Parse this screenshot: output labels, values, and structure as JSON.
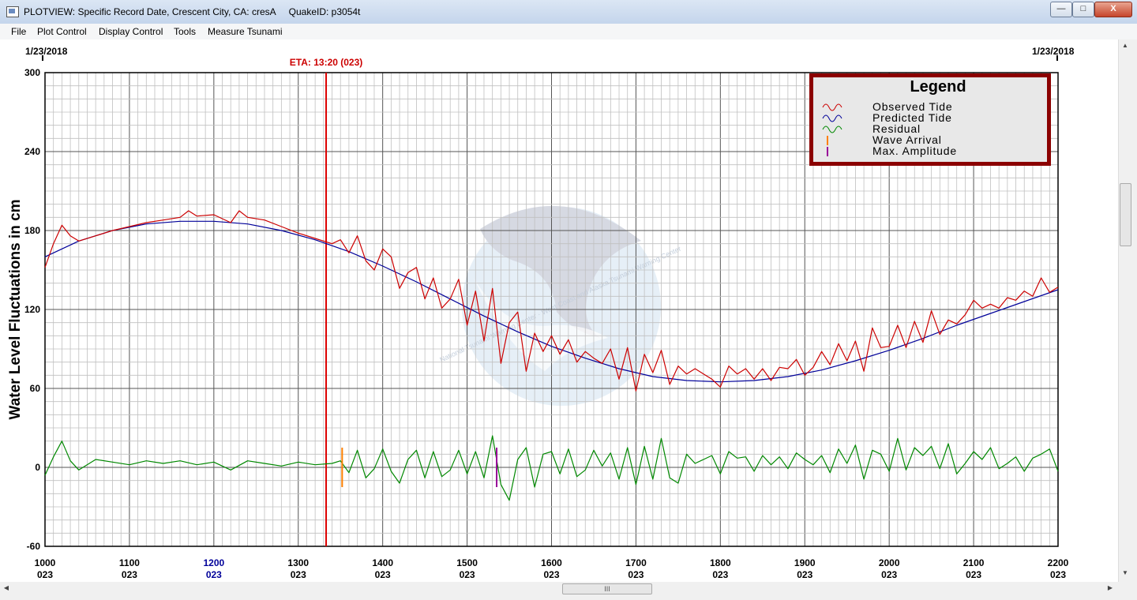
{
  "window": {
    "title": "PLOTVIEW: Specific Record Date, Crescent City, CA: cresA     QuakeID: p3054t",
    "minimize": "—",
    "maximize": "□",
    "close": "X"
  },
  "menu": [
    "File",
    "Plot Control",
    "Display Control",
    "Tools",
    "Measure Tsunami"
  ],
  "plot": {
    "date_left": "1/23/2018",
    "date_right": "1/23/2018",
    "eta_label": "ETA: 13:20 (023)",
    "eta_time": 1333,
    "ylabel": "Water Level Fluctuations in cm",
    "watermark_text": "National Tsunami Warning Center · West Coast and Alaska Tsunami Warning Center",
    "legend": {
      "title": "Legend",
      "items": [
        {
          "label": "Observed Tide",
          "symbol": "wave",
          "color": "#cc0000"
        },
        {
          "label": "Predicted Tide",
          "symbol": "wave",
          "color": "#000099"
        },
        {
          "label": "Residual",
          "symbol": "wave",
          "color": "#008800"
        },
        {
          "label": "Wave Arrival",
          "symbol": "bar",
          "color": "#ff8000"
        },
        {
          "label": "Max. Amplitude",
          "symbol": "bar",
          "color": "#990099"
        }
      ]
    },
    "scrollbar_grip": "III"
  },
  "chart_data": {
    "type": "line",
    "xlim": [
      1000,
      2200
    ],
    "ylim": [
      -60,
      300
    ],
    "yticks": [
      300,
      240,
      180,
      120,
      60,
      0,
      -60
    ],
    "xticks": [
      {
        "time": "1000",
        "day": "023",
        "t": 1000,
        "color": "#000000"
      },
      {
        "time": "1100",
        "day": "023",
        "t": 1100,
        "color": "#000000"
      },
      {
        "time": "1200",
        "day": "023",
        "t": 1200,
        "color": "#000099"
      },
      {
        "time": "1300",
        "day": "023",
        "t": 1300,
        "color": "#000000"
      },
      {
        "time": "1400",
        "day": "023",
        "t": 1400,
        "color": "#000000"
      },
      {
        "time": "1500",
        "day": "023",
        "t": 1500,
        "color": "#000000"
      },
      {
        "time": "1600",
        "day": "023",
        "t": 1600,
        "color": "#000000"
      },
      {
        "time": "1700",
        "day": "023",
        "t": 1700,
        "color": "#000000"
      },
      {
        "time": "1800",
        "day": "023",
        "t": 1800,
        "color": "#000000"
      },
      {
        "time": "1900",
        "day": "023",
        "t": 1900,
        "color": "#000000"
      },
      {
        "time": "2000",
        "day": "023",
        "t": 2000,
        "color": "#000000"
      },
      {
        "time": "2100",
        "day": "023",
        "t": 2100,
        "color": "#000000"
      },
      {
        "time": "2200",
        "day": "023",
        "t": 2200,
        "color": "#000000"
      }
    ],
    "series": [
      {
        "name": "Predicted Tide",
        "color": "#000099",
        "x": [
          1000,
          1040,
          1080,
          1120,
          1160,
          1200,
          1240,
          1280,
          1320,
          1360,
          1400,
          1440,
          1480,
          1520,
          1560,
          1600,
          1640,
          1680,
          1720,
          1760,
          1800,
          1840,
          1880,
          1920,
          1960,
          2000,
          2040,
          2080,
          2120,
          2160,
          2200
        ],
        "y": [
          160,
          172,
          180,
          185,
          187,
          187,
          185,
          180,
          173,
          164,
          153,
          141,
          128,
          115,
          103,
          92,
          83,
          75,
          69,
          66,
          65,
          66,
          69,
          74,
          81,
          89,
          98,
          108,
          117,
          126,
          135
        ]
      },
      {
        "name": "Observed Tide",
        "color": "#cc0000",
        "x": [
          1000,
          1010,
          1020,
          1030,
          1040,
          1060,
          1080,
          1100,
          1120,
          1140,
          1160,
          1170,
          1180,
          1200,
          1220,
          1230,
          1240,
          1260,
          1280,
          1300,
          1320,
          1340,
          1350,
          1360,
          1370,
          1380,
          1390,
          1400,
          1410,
          1420,
          1430,
          1440,
          1450,
          1460,
          1470,
          1480,
          1490,
          1500,
          1510,
          1520,
          1530,
          1540,
          1550,
          1560,
          1570,
          1580,
          1590,
          1600,
          1610,
          1620,
          1630,
          1640,
          1650,
          1660,
          1670,
          1680,
          1690,
          1700,
          1710,
          1720,
          1730,
          1740,
          1750,
          1760,
          1770,
          1780,
          1790,
          1800,
          1810,
          1820,
          1830,
          1840,
          1850,
          1860,
          1870,
          1880,
          1890,
          1900,
          1910,
          1920,
          1930,
          1940,
          1950,
          1960,
          1970,
          1980,
          1990,
          2000,
          2010,
          2020,
          2030,
          2040,
          2050,
          2060,
          2070,
          2080,
          2090,
          2100,
          2110,
          2120,
          2130,
          2140,
          2150,
          2160,
          2170,
          2180,
          2190,
          2200
        ],
        "y": [
          152,
          170,
          184,
          176,
          172,
          176,
          180,
          183,
          186,
          188,
          190,
          195,
          191,
          192,
          186,
          195,
          190,
          188,
          183,
          178,
          174,
          170,
          173,
          163,
          176,
          157,
          150,
          166,
          160,
          136,
          148,
          152,
          128,
          144,
          121,
          128,
          143,
          108,
          134,
          96,
          136,
          79,
          110,
          118,
          73,
          102,
          88,
          100,
          86,
          97,
          80,
          88,
          83,
          79,
          90,
          67,
          91,
          58,
          86,
          72,
          89,
          63,
          77,
          71,
          75,
          71,
          67,
          61,
          77,
          71,
          75,
          67,
          75,
          66,
          76,
          75,
          82,
          70,
          76,
          88,
          78,
          94,
          81,
          96,
          73,
          106,
          91,
          92,
          108,
          91,
          111,
          95,
          119,
          101,
          112,
          109,
          116,
          127,
          121,
          124,
          121,
          129,
          127,
          134,
          130,
          144,
          133,
          137
        ]
      },
      {
        "name": "Residual",
        "color": "#008800",
        "x": [
          1000,
          1010,
          1020,
          1030,
          1040,
          1060,
          1080,
          1100,
          1120,
          1140,
          1160,
          1180,
          1200,
          1220,
          1240,
          1260,
          1280,
          1300,
          1320,
          1340,
          1350,
          1360,
          1370,
          1380,
          1390,
          1400,
          1410,
          1420,
          1430,
          1440,
          1450,
          1460,
          1470,
          1480,
          1490,
          1500,
          1510,
          1520,
          1530,
          1540,
          1550,
          1560,
          1570,
          1580,
          1590,
          1600,
          1610,
          1620,
          1630,
          1640,
          1650,
          1660,
          1670,
          1680,
          1690,
          1700,
          1710,
          1720,
          1730,
          1740,
          1750,
          1760,
          1770,
          1780,
          1790,
          1800,
          1810,
          1820,
          1830,
          1840,
          1850,
          1860,
          1870,
          1880,
          1890,
          1900,
          1910,
          1920,
          1930,
          1940,
          1950,
          1960,
          1970,
          1980,
          1990,
          2000,
          2010,
          2020,
          2030,
          2040,
          2050,
          2060,
          2070,
          2080,
          2090,
          2100,
          2110,
          2120,
          2130,
          2140,
          2150,
          2160,
          2170,
          2180,
          2190,
          2200
        ],
        "y": [
          -6,
          8,
          20,
          5,
          -2,
          6,
          4,
          2,
          5,
          3,
          5,
          2,
          4,
          -2,
          5,
          3,
          1,
          4,
          2,
          3,
          5,
          -4,
          13,
          -8,
          -1,
          14,
          -3,
          -12,
          6,
          13,
          -8,
          12,
          -7,
          -2,
          13,
          -5,
          12,
          -8,
          24,
          -13,
          -25,
          6,
          15,
          -15,
          10,
          12,
          -5,
          14,
          -7,
          -2,
          13,
          1,
          11,
          -9,
          15,
          -13,
          16,
          -9,
          22,
          -8,
          -12,
          10,
          3,
          6,
          9,
          -5,
          12,
          7,
          8,
          -3,
          9,
          2,
          8,
          -1,
          11,
          6,
          2,
          9,
          -4,
          14,
          3,
          17,
          -9,
          13,
          10,
          -3,
          22,
          -2,
          15,
          9,
          16,
          -1,
          18,
          -5,
          3,
          12,
          6,
          15,
          -1,
          3,
          8,
          -3,
          7,
          10,
          14,
          -3
        ]
      }
    ],
    "wave_arrival": {
      "t": 1352,
      "y": [
        -15,
        15
      ]
    },
    "max_amplitude": {
      "t": 1535,
      "y": [
        -15,
        15
      ]
    }
  }
}
